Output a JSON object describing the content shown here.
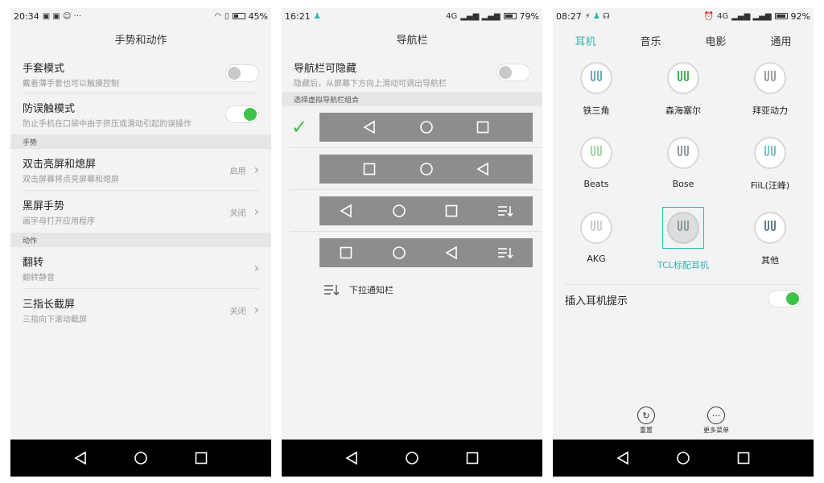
{
  "screen1": {
    "status": {
      "time": "20:34",
      "battery": "45%",
      "battery_level": 0.45
    },
    "title": "手势和动作",
    "rows": [
      {
        "title": "手套模式",
        "sub": "戴着薄手套也可以触摸控制",
        "toggle": "off"
      },
      {
        "title": "防误触模式",
        "sub": "防止手机在口袋中由于挤压或滑动引起的误操作",
        "toggle": "on"
      }
    ],
    "section_gesture": "手势",
    "gesture_rows": [
      {
        "title": "双击亮屏和熄屏",
        "sub": "双击屏幕将点亮屏幕和熄屏",
        "value": "启用"
      },
      {
        "title": "黑屏手势",
        "sub": "画字母打开应用程序",
        "value": "关闭"
      }
    ],
    "section_action": "动作",
    "action_rows": [
      {
        "title": "翻转",
        "sub": "翻转静音",
        "value": ""
      },
      {
        "title": "三指长截屏",
        "sub": "三指向下滚动截屏",
        "value": "关闭"
      }
    ]
  },
  "screen2": {
    "status": {
      "time": "16:21",
      "battery": "79%",
      "battery_level": 0.79,
      "signal": "4G"
    },
    "title": "导航栏",
    "hide_row": {
      "title": "导航栏可隐藏",
      "sub": "隐藏后，从屏幕下方向上滑动可调出导航栏",
      "toggle": "off"
    },
    "section": "选择虚拟导航栏组合",
    "legend": "下拉通知栏"
  },
  "screen3": {
    "status": {
      "time": "08:27",
      "battery": "92%",
      "battery_level": 0.92,
      "signal": "4G"
    },
    "tabs": [
      "耳机",
      "音乐",
      "电影",
      "通用"
    ],
    "headphones": [
      "铁三角",
      "森海塞尔",
      "拜亚动力",
      "Beats",
      "Bose",
      "FiiL(汪峰)",
      "AKG",
      "TCL标配耳机",
      "其他"
    ],
    "selected_index": 7,
    "insert_tip": "插入耳机提示",
    "actions": {
      "reset": "重置",
      "more": "更多菜单"
    }
  },
  "colors": {
    "accent": "#33b6b0",
    "toggle_on": "#3fc24a",
    "nav_option_bg": "#8d8d8d"
  }
}
